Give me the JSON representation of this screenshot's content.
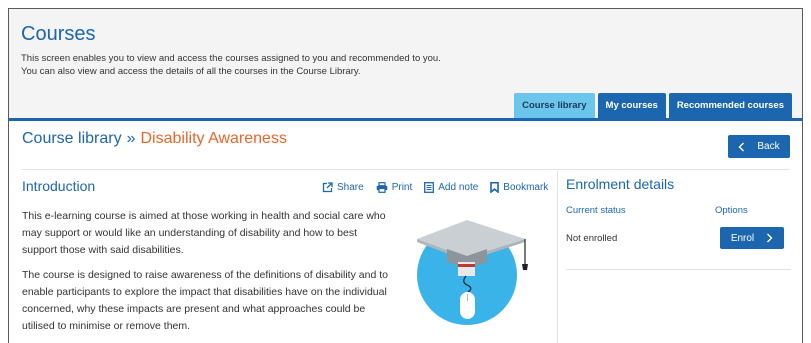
{
  "header": {
    "title": "Courses",
    "description_line1": "This screen enables you to view and access the courses assigned to you and recommended to you.",
    "description_line2": "You can also view and access the details of all the courses in the Course Library."
  },
  "tabs": [
    {
      "label": "Course library",
      "active": true
    },
    {
      "label": "My courses",
      "active": false
    },
    {
      "label": "Recommended courses",
      "active": false
    }
  ],
  "breadcrumb": {
    "parent": "Course library",
    "separator": "»",
    "current": "Disability Awareness"
  },
  "back_button": {
    "label": "Back",
    "icon": "chevron-left-icon"
  },
  "introduction": {
    "title": "Introduction",
    "actions": [
      {
        "label": "Share",
        "icon": "share-icon"
      },
      {
        "label": "Print",
        "icon": "printer-icon"
      },
      {
        "label": "Add note",
        "icon": "note-icon"
      },
      {
        "label": "Bookmark",
        "icon": "bookmark-icon"
      }
    ],
    "paragraph1": "This e-learning course is aimed at those working in health and social care who may support or would like an understanding of disability and how to best support those with said disabilities.",
    "paragraph2": "The course is designed to raise awareness of the definitions of disability and to enable participants to explore the impact that disabilities have on the individual concerned, why these impacts are present and what approaches could be utilised to minimise or remove them."
  },
  "enrolment": {
    "title": "Enrolment details",
    "status_label": "Current status",
    "options_label": "Options",
    "status_value": "Not enrolled",
    "enrol_button": "Enrol"
  },
  "colors": {
    "brand_blue": "#1c66b0",
    "active_tab": "#6cc6ec",
    "accent_orange": "#e8672a",
    "illustration_circle": "#3ab3e8"
  }
}
